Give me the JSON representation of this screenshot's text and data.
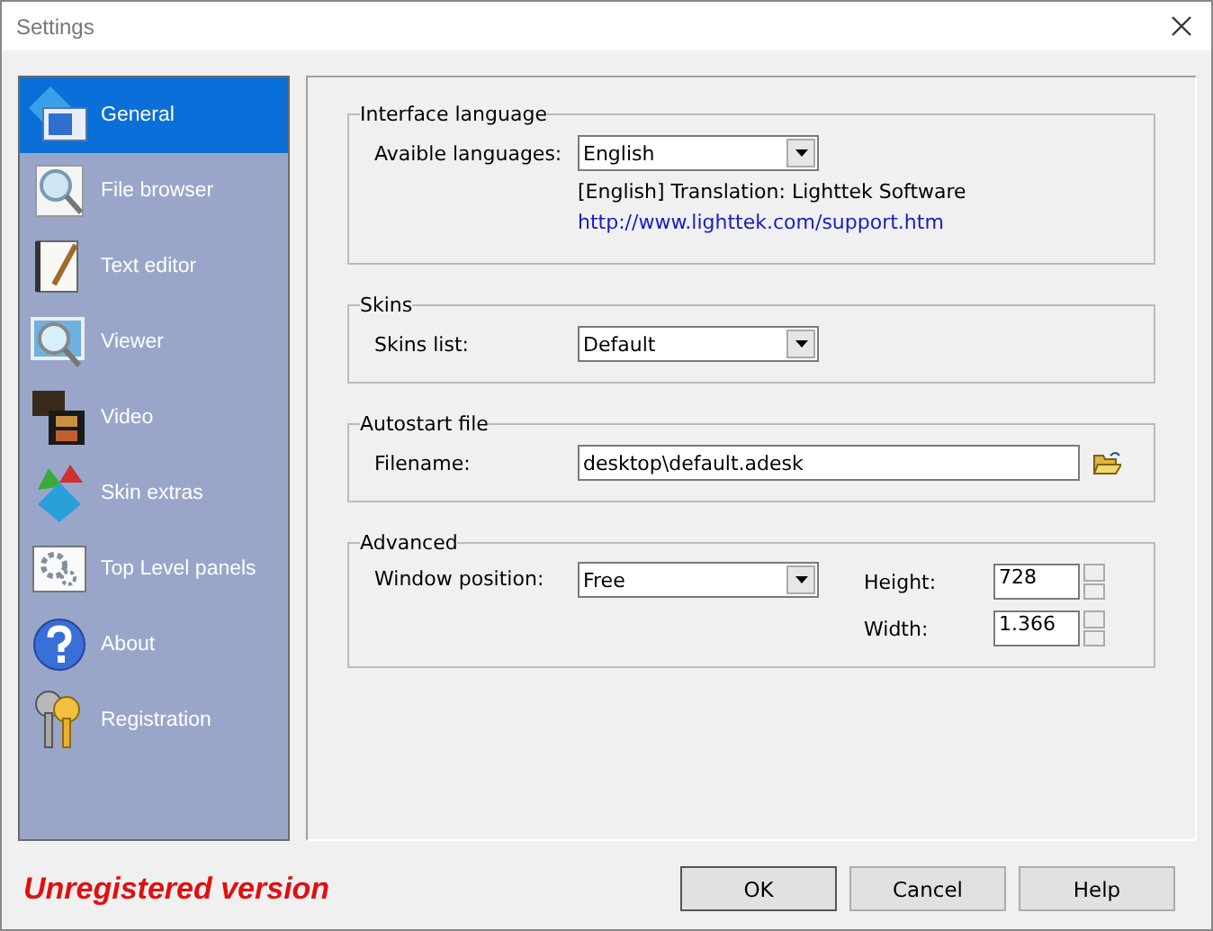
{
  "window": {
    "title": "Settings"
  },
  "sidebar": {
    "items": [
      {
        "label": "General",
        "selected": true
      },
      {
        "label": "File browser",
        "selected": false
      },
      {
        "label": "Text editor",
        "selected": false
      },
      {
        "label": "Viewer",
        "selected": false
      },
      {
        "label": "Video",
        "selected": false
      },
      {
        "label": "Skin extras",
        "selected": false
      },
      {
        "label": "Top Level panels",
        "selected": false
      },
      {
        "label": "About",
        "selected": false
      },
      {
        "label": "Registration",
        "selected": false
      }
    ]
  },
  "groups": [
    {
      "title": "Interface language",
      "rows": [
        {
          "kind": "dropdown",
          "label": "Avaible languages:",
          "value": "English"
        },
        {
          "kind": "note",
          "text": "[English] Translation: Lighttek Software"
        },
        {
          "kind": "link",
          "text": "http://www.lighttek.com/support.htm"
        }
      ]
    },
    {
      "title": "Skins",
      "rows": [
        {
          "kind": "dropdown",
          "label": "Skins list:",
          "value": "Default"
        }
      ]
    },
    {
      "title": "Autostart file",
      "rows": [
        {
          "kind": "file",
          "label": "Filename:",
          "value": "desktop\\default.adesk"
        }
      ]
    },
    {
      "title": "Advanced",
      "rows": [
        {
          "kind": "dropdown-spins",
          "label": "Window position:",
          "value": "Free",
          "spins": [
            {
              "label": "Height:",
              "value": "728"
            },
            {
              "label": "Width:",
              "value": "1.366"
            }
          ]
        }
      ]
    }
  ],
  "footer": {
    "status": "Unregistered version",
    "buttons": [
      "OK",
      "Cancel",
      "Help"
    ]
  }
}
